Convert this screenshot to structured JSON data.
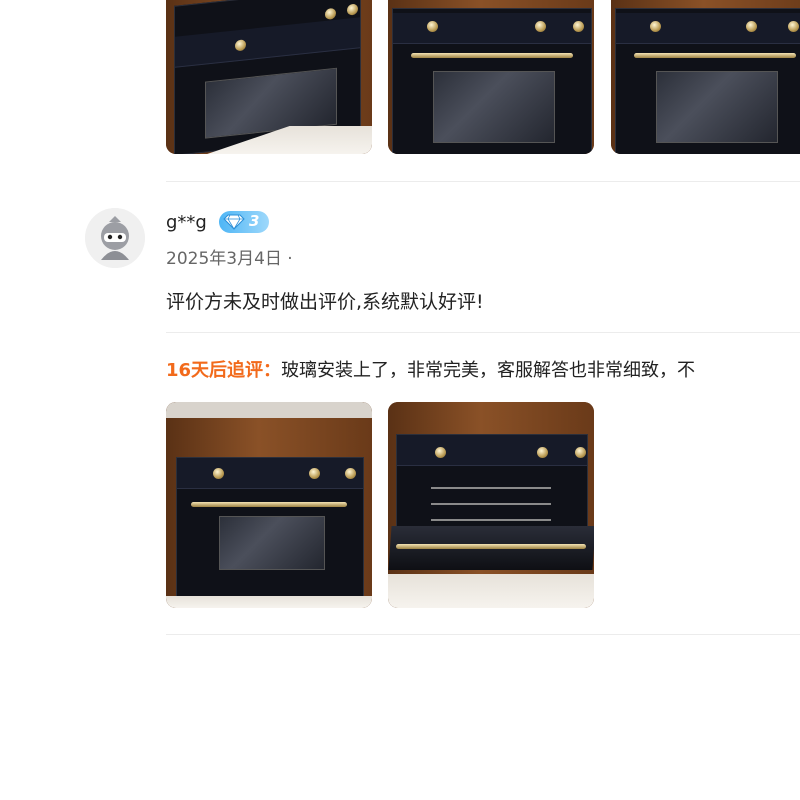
{
  "previous_review": {
    "images": [
      "oven photo",
      "oven photo",
      "oven photo"
    ]
  },
  "review": {
    "username": "g**g",
    "badge": {
      "icon": "diamond-icon",
      "level": "3",
      "color": "#4fb6f5"
    },
    "date": "2025年3月4日 ·",
    "text": "评价方未及时做出评价,系统默认好评!",
    "followup": {
      "label": "16天后追评：",
      "text": "玻璃安装上了，非常完美，客服解答也非常细致，不",
      "label_color": "#f26a1b"
    },
    "images": [
      "oven photo",
      "oven photo"
    ]
  }
}
